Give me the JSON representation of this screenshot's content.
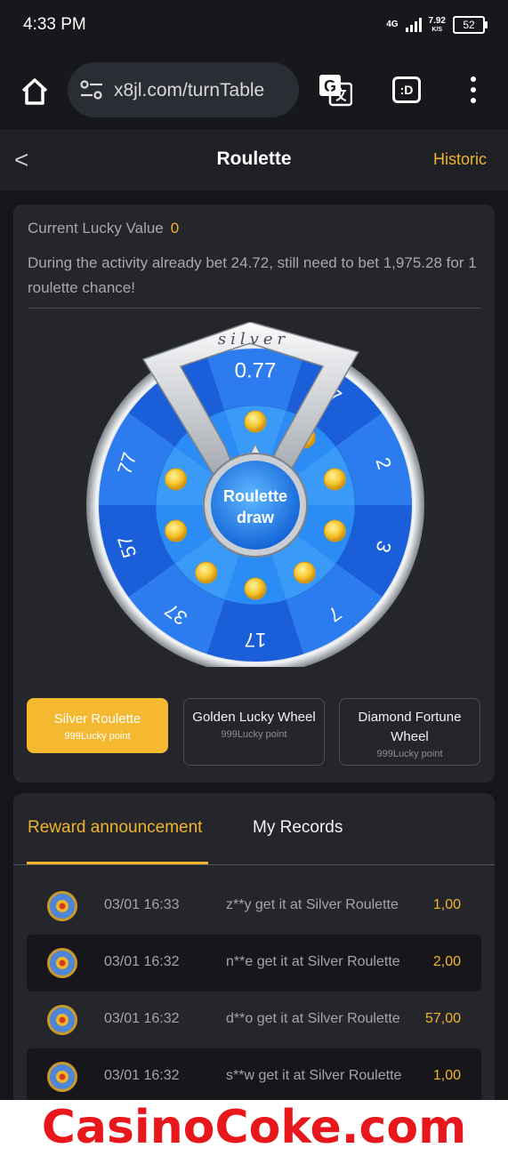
{
  "status": {
    "time": "4:33 PM",
    "network": "4G",
    "speed_value": "7.92",
    "speed_unit": "K/S",
    "battery": "52"
  },
  "browser": {
    "url": "x8jl.com/turnTable",
    "mode_label": ":D"
  },
  "header": {
    "title": "Roulette",
    "back": "<",
    "historic": "Historic"
  },
  "lucky": {
    "label": "Current Lucky Value",
    "value": "0"
  },
  "description": "During the activity already bet 24.72, still need to bet 1,975.28 for 1 roulette chance!",
  "wheel": {
    "brand": "silver",
    "top_value": "0.77",
    "segments": [
      "0.77",
      "7",
      "2",
      "3",
      "7",
      "17",
      "37",
      "57",
      "77",
      "17"
    ],
    "center_line1": "Roulette",
    "center_line2": "draw"
  },
  "roulette_tabs": [
    {
      "name": "Silver Roulette",
      "points": "999Lucky point"
    },
    {
      "name": "Golden Lucky Wheel",
      "points": "999Lucky point"
    },
    {
      "name": "Diamond Fortune Wheel",
      "points": "999Lucky point"
    }
  ],
  "announcement": {
    "tab_reward": "Reward announcement",
    "tab_records": "My Records",
    "rows": [
      {
        "time": "03/01 16:33",
        "msg": "z**y get it at Silver Roulette",
        "value": "1,00"
      },
      {
        "time": "03/01 16:32",
        "msg": "n**e get it at Silver Roulette",
        "value": "2,00"
      },
      {
        "time": "03/01 16:32",
        "msg": "d**o get it at Silver Roulette",
        "value": "57,00"
      },
      {
        "time": "03/01 16:32",
        "msg": "s**w get it at Silver Roulette",
        "value": "1,00"
      }
    ]
  },
  "watermark": "CasinoCoke.com"
}
